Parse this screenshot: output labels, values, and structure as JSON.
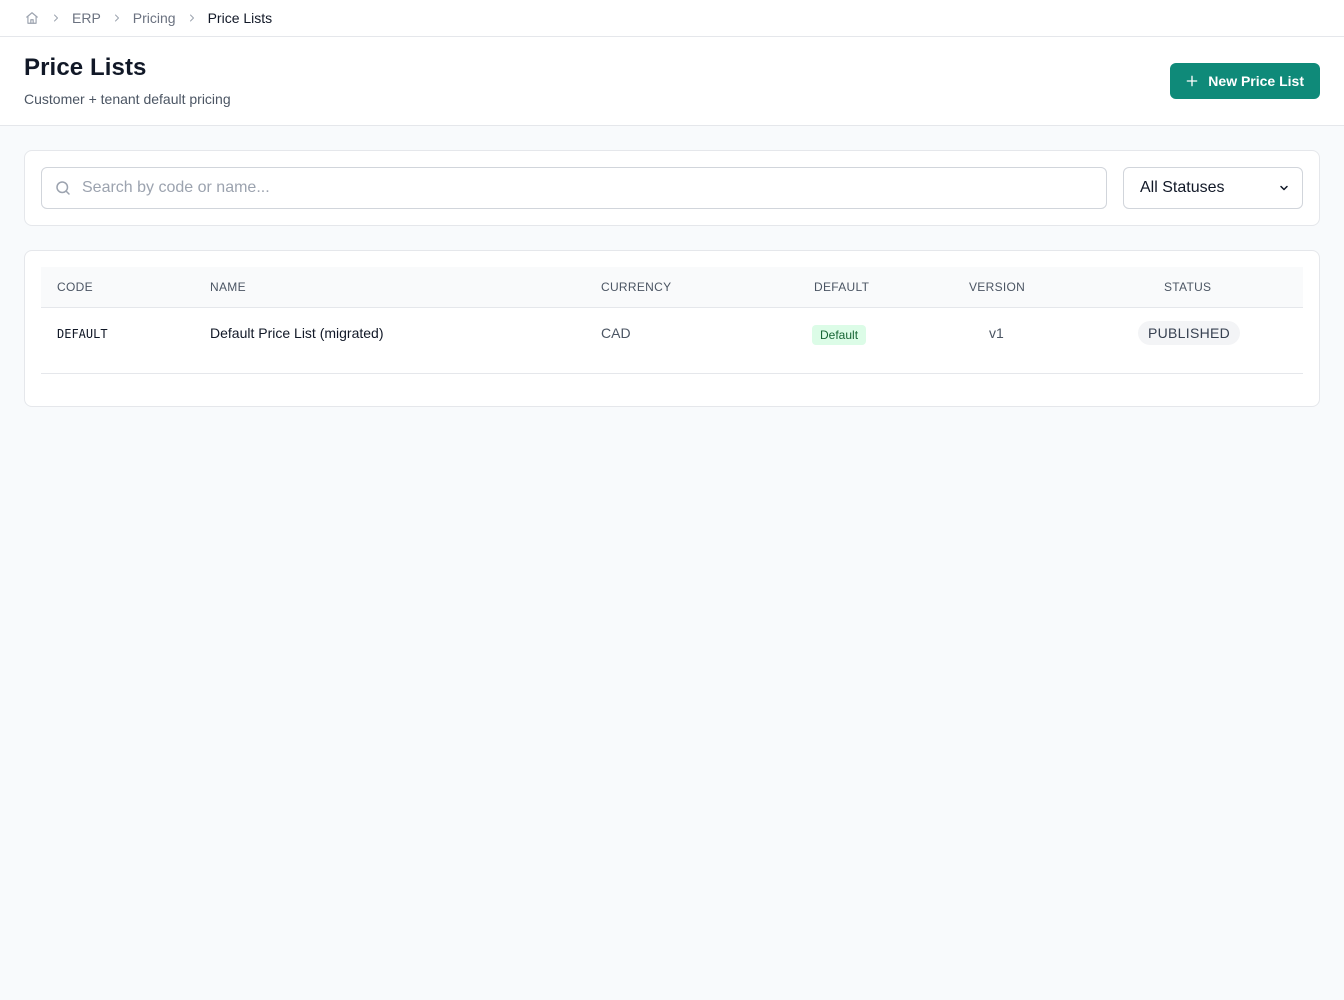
{
  "breadcrumb": {
    "items": [
      {
        "label": "ERP"
      },
      {
        "label": "Pricing"
      }
    ],
    "current": "Price Lists"
  },
  "header": {
    "title": "Price Lists",
    "subtitle": "Customer + tenant default pricing",
    "new_button_label": "New Price List"
  },
  "filters": {
    "search_placeholder": "Search by code or name...",
    "search_value": "",
    "status_selected": "All Statuses"
  },
  "table": {
    "columns": [
      "CODE",
      "NAME",
      "CURRENCY",
      "DEFAULT",
      "VERSION",
      "STATUS"
    ],
    "rows": [
      {
        "code": "DEFAULT",
        "name": "Default Price List (migrated)",
        "currency": "CAD",
        "default": "Default",
        "version": "v1",
        "status": "PUBLISHED"
      }
    ]
  },
  "colors": {
    "accent": "#0f8a79",
    "default_badge_bg": "#dcfce7",
    "default_badge_text": "#166534",
    "status_badge_bg": "#f3f4f6"
  },
  "icons": {
    "home": "home-icon",
    "separator": "chevron-right-icon",
    "new": "plus-icon",
    "search": "search-icon",
    "select": "chevron-down-icon"
  }
}
